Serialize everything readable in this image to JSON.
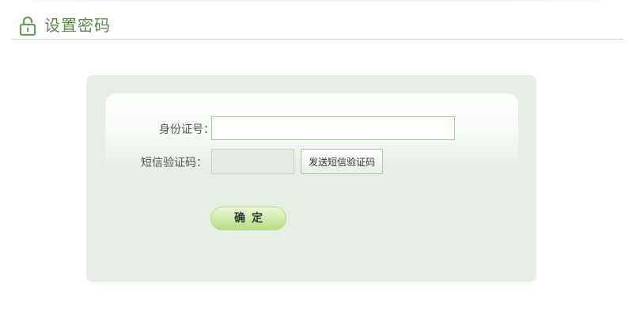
{
  "header": {
    "title": "设置密码",
    "icon": "lock-icon"
  },
  "form": {
    "id_label": "身份证号：",
    "id_value": "",
    "sms_label": "短信验证码：",
    "sms_value": "",
    "send_button": "发送短信验证码",
    "confirm_button": "确定"
  },
  "colors": {
    "accent": "#5a8a4a",
    "panel": "#e7eee6",
    "confirm": "#cfe8a6"
  }
}
